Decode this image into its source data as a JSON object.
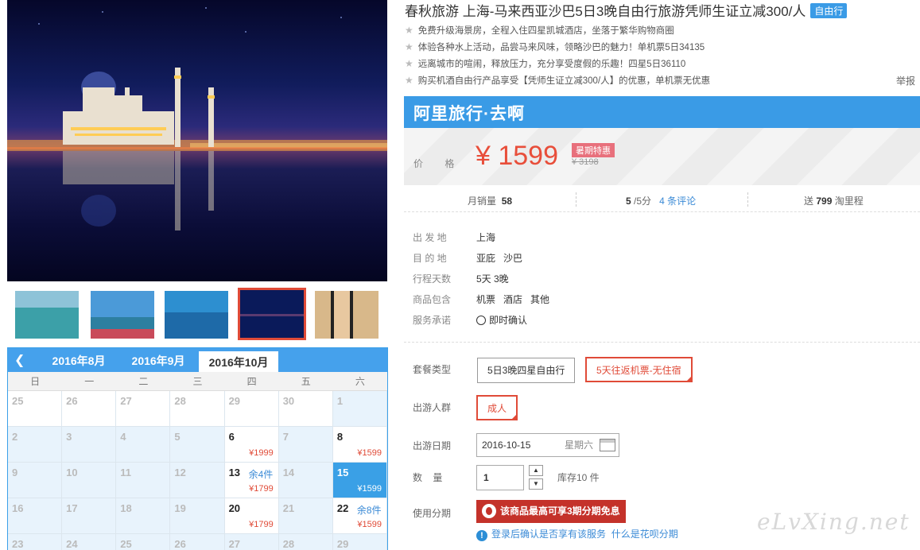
{
  "product": {
    "title": "春秋旅游 上海-马来西亚沙巴5日3晚自由行旅游凭师生证立减300/人",
    "tag": "自由行",
    "features": [
      "免费升级海景房，全程入住四星凯城酒店，坐落于繁华购物商圈",
      "体验各种水上活动，品尝马来风味，领略沙巴的魅力！单机票5日34135",
      "远离城市的喧闹，释放压力，充分享受度假的乐趣！四星5日36110",
      "购买机酒自由行产品享受【凭师生证立减300/人】的优惠，单机票无优惠"
    ],
    "report": "举报"
  },
  "banner": {
    "text": "阿里旅行·去啊",
    "color": "#3a9be6"
  },
  "price": {
    "label": "价 格",
    "value": "¥ 1599",
    "promo": "暑期特惠",
    "original": "¥ 3198",
    "color": "#e84e3a"
  },
  "stats": {
    "monthly_label": "月销量",
    "monthly_value": "58",
    "rating": "5",
    "rating_suffix": "/5分",
    "reviews": "4 条评论",
    "points_prefix": "送",
    "points_value": "799",
    "points_suffix": "淘里程"
  },
  "info": [
    {
      "label": "出 发 地",
      "value": "上海"
    },
    {
      "label": "目 的 地",
      "value": "亚庇   沙巴"
    },
    {
      "label": "行程天数",
      "value": "5天 3晚"
    },
    {
      "label": "商品包含",
      "value": "机票   酒店   其他"
    },
    {
      "label": "服务承诺",
      "value": "即时确认"
    }
  ],
  "options": {
    "package_label": "套餐类型",
    "package_a": "5日3晚四星自由行",
    "package_b": "5天往返机票-无住宿",
    "crowd_label": "出游人群",
    "crowd_value": "成人",
    "date_label": "出游日期",
    "date_value": "2016-10-15",
    "date_week": "星期六",
    "qty_label": "数    量",
    "qty_value": "1",
    "stock": "库存10 件",
    "install_label": "使用分期",
    "install_btn": "该商品最高可享3期分期免息",
    "install_note_a": "登录后确认是否享有该服务",
    "install_note_b": "什么是花呗分期"
  },
  "calendar": {
    "months": [
      "2016年8月",
      "2016年9月",
      "2016年10月"
    ],
    "active_month": 2,
    "weekdays": [
      "日",
      "一",
      "二",
      "三",
      "四",
      "五",
      "六"
    ],
    "weeks": [
      [
        {
          "d": "25"
        },
        {
          "d": "26"
        },
        {
          "d": "27"
        },
        {
          "d": "28"
        },
        {
          "d": "29"
        },
        {
          "d": "30"
        },
        {
          "d": "1",
          "dim": true
        }
      ],
      [
        {
          "d": "2",
          "dim": true
        },
        {
          "d": "3",
          "dim": true
        },
        {
          "d": "4",
          "dim": true
        },
        {
          "d": "5",
          "dim": true
        },
        {
          "d": "6",
          "avail": true,
          "price": "¥1999"
        },
        {
          "d": "7",
          "dim": true
        },
        {
          "d": "8",
          "avail": true,
          "price": "¥1599"
        }
      ],
      [
        {
          "d": "9",
          "dim": true
        },
        {
          "d": "10",
          "dim": true
        },
        {
          "d": "11",
          "dim": true
        },
        {
          "d": "12",
          "dim": true
        },
        {
          "d": "13",
          "avail": true,
          "left": "余4件",
          "price": "¥1799"
        },
        {
          "d": "14",
          "dim": true
        },
        {
          "d": "15",
          "sel": true,
          "price": "¥1599"
        }
      ],
      [
        {
          "d": "16",
          "dim": true
        },
        {
          "d": "17",
          "dim": true
        },
        {
          "d": "18",
          "dim": true
        },
        {
          "d": "19",
          "dim": true
        },
        {
          "d": "20",
          "avail": true,
          "price": "¥1799"
        },
        {
          "d": "21",
          "dim": true
        },
        {
          "d": "22",
          "avail": true,
          "left": "余8件",
          "price": "¥1599"
        }
      ],
      [
        {
          "d": "23",
          "dim": true
        },
        {
          "d": "24",
          "dim": true
        },
        {
          "d": "25",
          "dim": true
        },
        {
          "d": "26",
          "dim": true
        },
        {
          "d": "27",
          "dim": true
        },
        {
          "d": "28",
          "dim": true
        },
        {
          "d": "29",
          "dim": true
        }
      ]
    ]
  },
  "watermark": "eLvXing.net"
}
